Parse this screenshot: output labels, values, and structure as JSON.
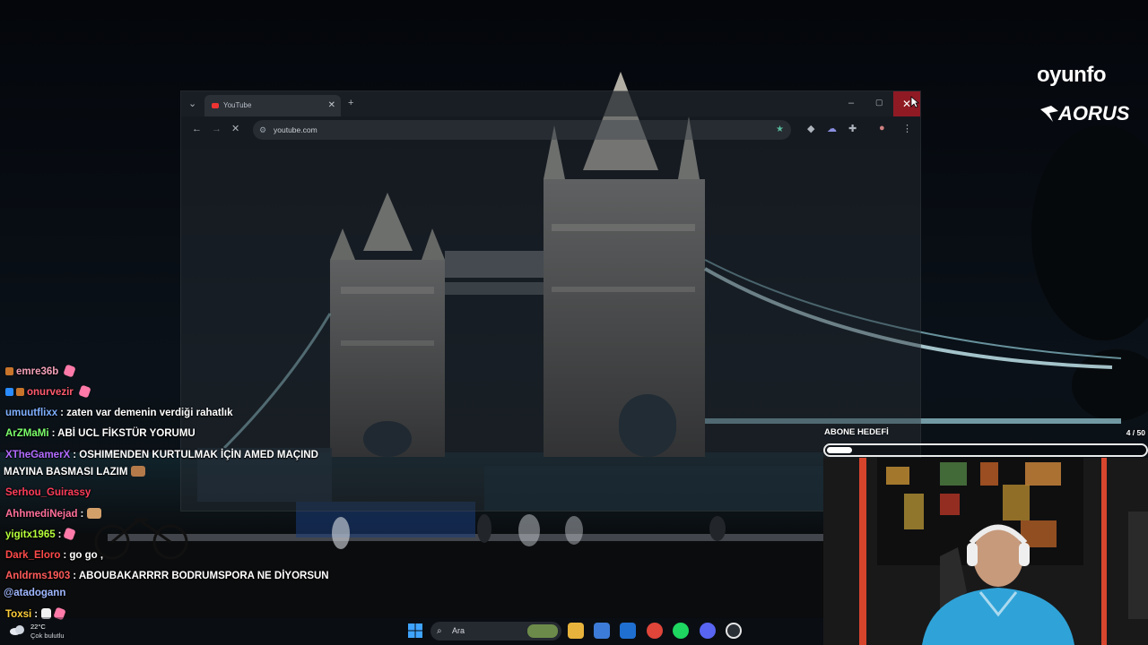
{
  "browser": {
    "tab_title": "YouTube",
    "new_tab": "+",
    "address": "youtube.com",
    "minimize": "–",
    "maximize": "▢",
    "close": "✕"
  },
  "overlay": {
    "brand_primary": "oyunfo",
    "brand_secondary": "AORUS"
  },
  "chat": {
    "messages": [
      {
        "user": "emre36b",
        "color": "#f2a0b8",
        "text": ""
      },
      {
        "user": "onurvezir",
        "color": "#ff5a6e",
        "text": ""
      },
      {
        "user": "umuutflixx",
        "color": "#7fb0ff",
        "text": ": zaten var demenin verdiği rahatlık"
      },
      {
        "user": "ArZMaMi",
        "color": "#7cff6a",
        "text": ": ABİ UCL FİKSTÜR YORUMU"
      },
      {
        "user": "XTheGamerX",
        "color": "#b36bff",
        "text": ": OSHIMENDEN KURTULMAK İÇİN AMED MAÇIND"
      },
      {
        "user": "",
        "color": "#ffffff",
        "text": "MAYINA BASMASI LAZIM"
      },
      {
        "user": "Serhou_Guirassy",
        "color": "#ff3d5a",
        "text": ""
      },
      {
        "user": "AhhmediNejad",
        "color": "#ff6f9a",
        "text": ":"
      },
      {
        "user": "yigitx1965",
        "color": "#b7ff3a",
        "text": ":"
      },
      {
        "user": "Dark_Eloro",
        "color": "#ff4a4a",
        "text": ": go go ,"
      },
      {
        "user": "Anldrms1903",
        "color": "#ff5a5a",
        "text": ": ABOUBAKARRRR BODRUMSPORA NE DİYORSUN"
      },
      {
        "user": "",
        "color": "#9fb8ff",
        "text": "@atadogann"
      },
      {
        "user": "Toxsi",
        "color": "#ffcf3a",
        "text": ":"
      }
    ]
  },
  "goal": {
    "title": "ABONE HEDEFİ",
    "count": "4 / 50",
    "progress": 0.08
  },
  "taskbar": {
    "temperature": "22°C",
    "condition": "Çok bulutlu",
    "search_placeholder": "Ara"
  }
}
